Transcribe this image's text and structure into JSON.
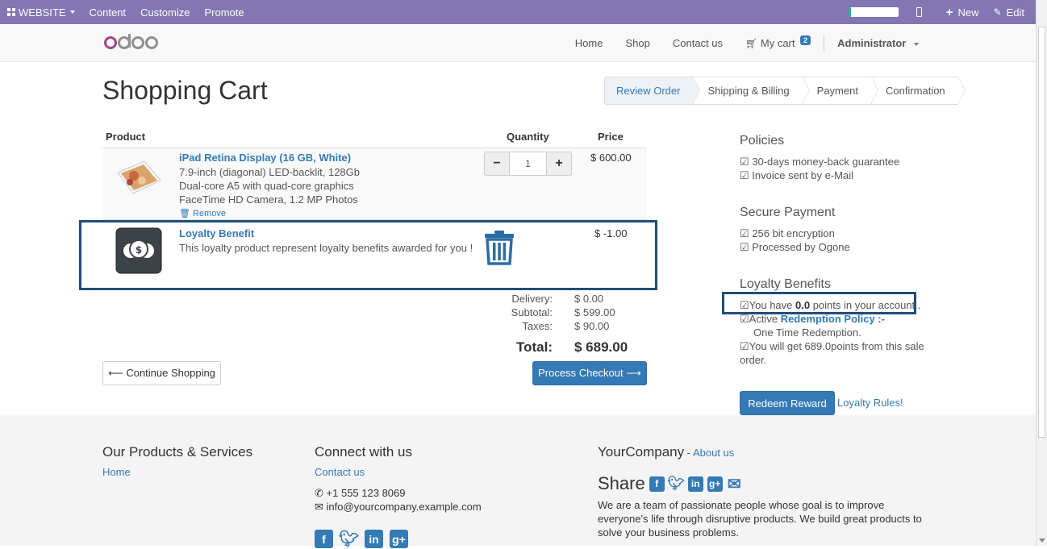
{
  "admin_bar": {
    "website_label": "WEBSITE",
    "content_label": "Content",
    "customize_label": "Customize",
    "promote_label": "Promote",
    "new_label": "New",
    "edit_label": "Edit"
  },
  "header": {
    "logo_text": "odoo",
    "nav": [
      "Home",
      "Shop",
      "Contact us"
    ],
    "cart_label": "My cart",
    "cart_count": "2",
    "user_label": "Administrator"
  },
  "page_title": "Shopping Cart",
  "wizard": {
    "steps": [
      "Review Order",
      "Shipping & Billing",
      "Payment",
      "Confirmation"
    ]
  },
  "cart": {
    "headers": {
      "product": "Product",
      "quantity": "Quantity",
      "price": "Price"
    },
    "items": [
      {
        "name": "iPad Retina Display (16 GB, White)",
        "desc": [
          "7.9-inch (diagonal) LED-backlit, 128Gb",
          "Dual-core A5 with quad-core graphics",
          "FaceTime HD Camera, 1.2 MP Photos"
        ],
        "quantity": "1",
        "price": "$ 600.00",
        "remove_label": "Remove"
      },
      {
        "name": "Loyalty Benefit",
        "desc": "This loyalty product represent loyalty benefits awarded for you !",
        "price": "$ -1.00"
      }
    ],
    "totals": {
      "delivery_label": "Delivery:",
      "delivery": "$ 0.00",
      "subtotal_label": "Subtotal:",
      "subtotal": "$ 599.00",
      "taxes_label": "Taxes:",
      "taxes": "$ 90.00",
      "total_label": "Total:",
      "total": "$ 689.00"
    },
    "continue_label": "⟵ Continue Shopping",
    "checkout_label": "Process Checkout ⟶"
  },
  "sidebar": {
    "policies_title": "Policies",
    "policies": [
      "☑ 30-days money-back guarantee",
      "☑ Invoice sent by e-Mail"
    ],
    "secure_title": "Secure Payment",
    "secure": [
      "☑ 256 bit encryption",
      "☑ Processed by Ogone"
    ],
    "loyalty_title": "Loyalty Benefits",
    "points_prefix": "☑You have ",
    "points_value": "0.0",
    "points_suffix": " points in your account .",
    "active_prefix": "☑Active ",
    "redemption_policy": "Redemption Policy :-",
    "redemption_type": "One Time Redemption.",
    "will_get": "☑You will get 689.0points from this sale order.",
    "redeem_label": "Redeem Reward",
    "rules_label": "Loyalty Rules!"
  },
  "footer": {
    "products_title": "Our Products & Services",
    "products_link": "Home",
    "connect_title": "Connect with us",
    "contact_link": "Contact us",
    "phone": "+1 555 123 8069",
    "email": "info@yourcompany.example.com",
    "company_name": "YourCompany",
    "company_sep": " - ",
    "about_link": "About us",
    "share_label": "Share",
    "about_text": "We are a team of passionate people whose goal is to improve everyone's life through disruptive products. We build great products to solve your business problems."
  },
  "colors": {
    "admin_bar": "#8276b3",
    "primary": "#337ab7",
    "highlight_border": "#1f4e7a"
  }
}
